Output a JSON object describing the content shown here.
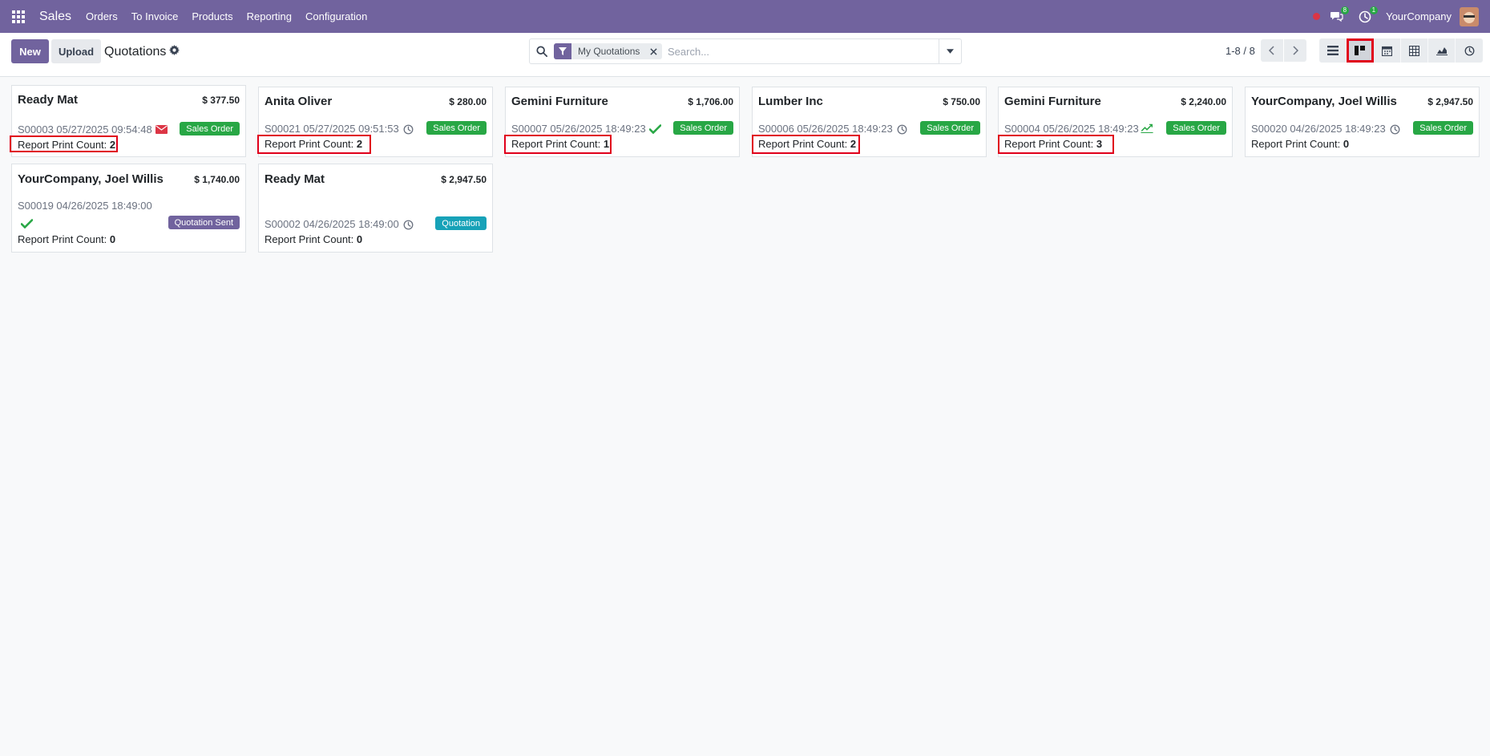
{
  "navbar": {
    "app_name": "Sales",
    "menu": [
      "Orders",
      "To Invoice",
      "Products",
      "Reporting",
      "Configuration"
    ],
    "messages_count": "8",
    "activities_count": "1",
    "company": "YourCompany"
  },
  "control_panel": {
    "new_label": "New",
    "upload_label": "Upload",
    "title": "Quotations",
    "search": {
      "facet": "My Quotations",
      "placeholder": "Search..."
    },
    "pager": "1-8 / 8",
    "active_view": "kanban"
  },
  "cards": [
    {
      "customer": "Ready Mat",
      "amount": "$ 377.50",
      "ref": "S00003 05/27/2025 09:54:48",
      "activity_icon": "envelope-icon",
      "activity_color": "#dc3545",
      "status": "Sales Order",
      "count_label": "Report Print Count:",
      "count": "2"
    },
    {
      "customer": "Anita Oliver",
      "amount": "$ 280.00",
      "ref": "S00021 05/27/2025 09:51:53",
      "activity_icon": "clock-icon",
      "activity_color": "#6b7280",
      "status": "Sales Order",
      "count_label": "Report Print Count:",
      "count": "2"
    },
    {
      "customer": "Gemini Furniture",
      "amount": "$ 1,706.00",
      "ref": "S00007 05/26/2025 18:49:23",
      "activity_icon": "check-icon",
      "activity_color": "#28a745",
      "status": "Sales Order",
      "count_label": "Report Print Count:",
      "count": "1"
    },
    {
      "customer": "Lumber Inc",
      "amount": "$ 750.00",
      "ref": "S00006 05/26/2025 18:49:23",
      "activity_icon": "clock-icon",
      "activity_color": "#6b7280",
      "status": "Sales Order",
      "count_label": "Report Print Count:",
      "count": "2"
    },
    {
      "customer": "Gemini Furniture",
      "amount": "$ 2,240.00",
      "ref": "S00004 05/26/2025 18:49:23",
      "activity_icon": "trend-icon",
      "activity_color": "#28a745",
      "status": "Sales Order",
      "count_label": "Report Print Count:",
      "count": "3"
    },
    {
      "customer": "YourCompany, Joel Willis",
      "amount": "$ 2,947.50",
      "ref": "S00020 04/26/2025 18:49:23",
      "activity_icon": "clock-icon",
      "activity_color": "#6b7280",
      "status": "Sales Order",
      "count_label": "Report Print Count:",
      "count": "0"
    },
    {
      "customer": "YourCompany, Joel Willis",
      "amount": "$ 1,740.00",
      "ref": "S00019 04/26/2025 18:49:00",
      "activity_icon": "check-icon",
      "activity_color": "#28a745",
      "status": "Quotation Sent",
      "count_label": "Report Print Count:",
      "count": "0"
    },
    {
      "customer": "Ready Mat",
      "amount": "$ 2,947.50",
      "ref": "S00002 04/26/2025 18:49:00",
      "activity_icon": "clock-icon",
      "activity_color": "#6b7280",
      "status": "Quotation",
      "count_label": "Report Print Count:",
      "count": "0"
    }
  ],
  "colors": {
    "brand": "#71639e",
    "sales_order": "#28a745",
    "quotation_sent": "#71639e",
    "quotation": "#17a2b8",
    "highlight": "#e0001b"
  }
}
